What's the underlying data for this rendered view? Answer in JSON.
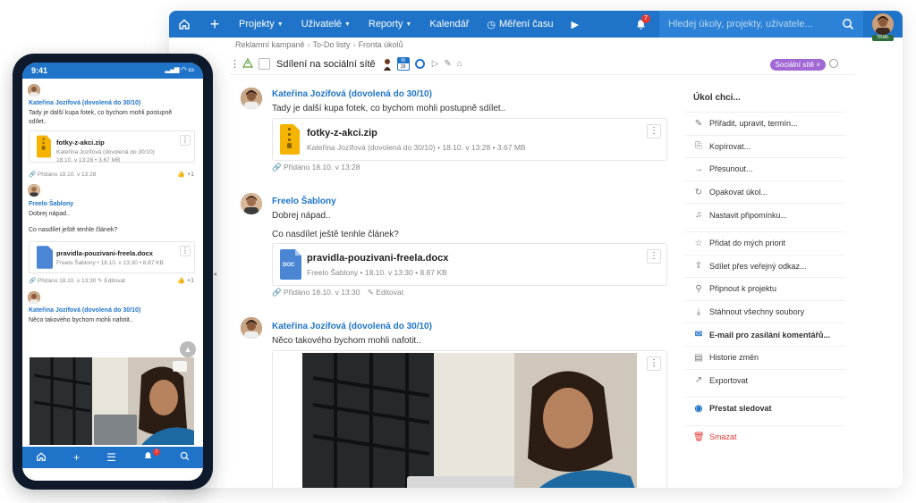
{
  "topbar": {
    "nav": [
      {
        "label": "Projekty",
        "caret": true
      },
      {
        "label": "Uživatelé",
        "caret": true
      },
      {
        "label": "Reporty",
        "caret": true
      },
      {
        "label": "Kalendář",
        "caret": false
      }
    ],
    "timer_label": "Měření času",
    "bell_badge": "7",
    "search_placeholder": "Hledej úkoly, projekty, uživatele...",
    "trial_label": "TRIAL"
  },
  "breadcrumb": [
    "Reklamní kampaně",
    "To-Do listy",
    "Fronta úkolů"
  ],
  "task": {
    "title": "Sdílení na sociální sítě",
    "cal_month": "Ri",
    "cal_day": "28",
    "tag": "Sociální sítě"
  },
  "comments": [
    {
      "author": "Kateřina Jozífová (dovolená do 30/10)",
      "text": "Tady je další kupa fotek, co bychom mohli postupně sdílet..",
      "file": {
        "name": "fotky-z-akci.zip",
        "meta": "Kateřina Jozífová (dovolená do 30/10)  •  18.10. v 13:28  •  3.67 MB"
      },
      "added": "Přidáno 18.10. v 13:28"
    },
    {
      "author": "Freelo Šablony",
      "text": "Dobrej nápad..",
      "text2": "Co nasdílet ještě tenhle článek?",
      "file": {
        "name": "pravidla-pouzivani-freela.docx",
        "meta": "Freelo Šablony  •  18.10. v 13:30  •  8.87 KB",
        "type": "DOC"
      },
      "added": "Přidáno 18.10. v 13:30",
      "edit": "Editovat"
    },
    {
      "author": "Kateřina Jozífová (dovolená do 30/10)",
      "text": "Něco takového bychom mohli nafotit.."
    }
  ],
  "panel": {
    "title": "Úkol chci...",
    "items": [
      {
        "label": "Přiřadit, upravit, termín...",
        "icon": "pencil-icon"
      },
      {
        "label": "Kopírovat...",
        "icon": "copy-icon"
      },
      {
        "label": "Přesunout...",
        "icon": "arrow-right-icon"
      },
      {
        "label": "Opakovat úkol...",
        "icon": "repeat-icon"
      },
      {
        "label": "Nastavit připomínku...",
        "icon": "bell-icon"
      },
      {
        "label": "Přidat do mých priorit",
        "icon": "star-icon"
      },
      {
        "label": "Sdílet přes veřejný odkaz...",
        "icon": "share-icon"
      },
      {
        "label": "Připnout k projektu",
        "icon": "pin-icon"
      },
      {
        "label": "Stáhnout všechny soubory",
        "icon": "download-icon"
      },
      {
        "label": "E-mail pro zasílání komentářů...",
        "icon": "mail-icon"
      },
      {
        "label": "Historie změn",
        "icon": "history-icon"
      },
      {
        "label": "Exportovat",
        "icon": "export-icon"
      },
      {
        "label": "Přestat sledovat",
        "icon": "eye-icon"
      },
      {
        "label": "Smazat",
        "icon": "trash-icon"
      }
    ]
  },
  "phone": {
    "time": "9:41",
    "c1": {
      "author": "Kateřina Jozífová (dovolená do 30/10)",
      "text": "Tady je další kupa fotek, co bychom mohli postupně sdílet..",
      "file_name": "fotky-z-akci.zip",
      "file_meta1": "Kateřina Jozífová (dovolená do 30/10)",
      "file_meta2": "18.10. v 13:28  •  3.67 MB",
      "added": "Přidáno 18.10. v 13:28",
      "likes": "+1"
    },
    "c2": {
      "author": "Freelo Šablony",
      "text": "Dobrej nápad..",
      "text2": "Co nasdílet ještě tenhle článek?",
      "file_name": "pravidla-pouzivani-freela.docx",
      "file_meta": "Freelo Šablony  •  18.10. v 13:30  •  8.87 KB",
      "added": "Přidáno 18.10. v 13:30",
      "edit": "Editovat",
      "likes": "+1"
    },
    "c3": {
      "author": "Kateřina Jozífová (dovolená do 30/10)",
      "text": "Něco takového bychom mohli nafotit.."
    },
    "nav_badge": "7"
  },
  "colors": {
    "brand": "#1f74c9",
    "tag": "#a168d6",
    "danger": "#e53935"
  }
}
